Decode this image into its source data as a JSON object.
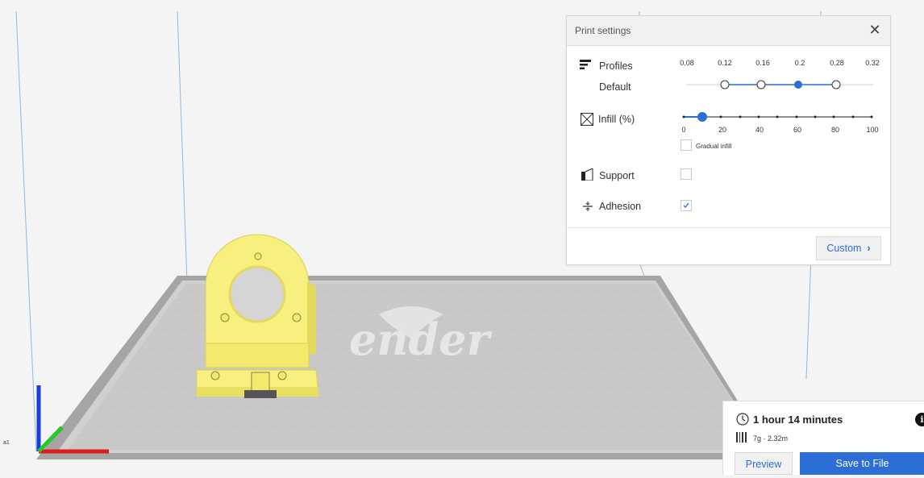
{
  "scene": {
    "bed_logo_text": "ender",
    "model_color": "#f7ef7e",
    "bed_color": "#c9c9c9",
    "axis_colors": {
      "x": "#e11a1a",
      "y": "#29c829",
      "z": "#1a3cde"
    },
    "side_text": "a1"
  },
  "print_settings": {
    "title": "Print settings",
    "close_icon": "close-icon",
    "profiles": {
      "label": "Profiles",
      "current": "Default",
      "values": [
        "0.08",
        "0.12",
        "0.16",
        "0.2",
        "0.28",
        "0.32"
      ],
      "selected": "0.2"
    },
    "infill": {
      "label": "Infill (%)",
      "ticks": [
        "0",
        "20",
        "40",
        "60",
        "80",
        "100"
      ],
      "value_percent": 10,
      "gradual_label": "Gradual infill",
      "gradual_checked": false
    },
    "support": {
      "label": "Support",
      "checked": false
    },
    "adhesion": {
      "label": "Adhesion",
      "checked": true
    },
    "custom_button": "Custom",
    "accent_color": "#2c6ed5"
  },
  "print_info": {
    "time": "1 hour 14 minutes",
    "material": "7g · 2.32m",
    "preview_button": "Preview",
    "save_button": "Save to File"
  }
}
